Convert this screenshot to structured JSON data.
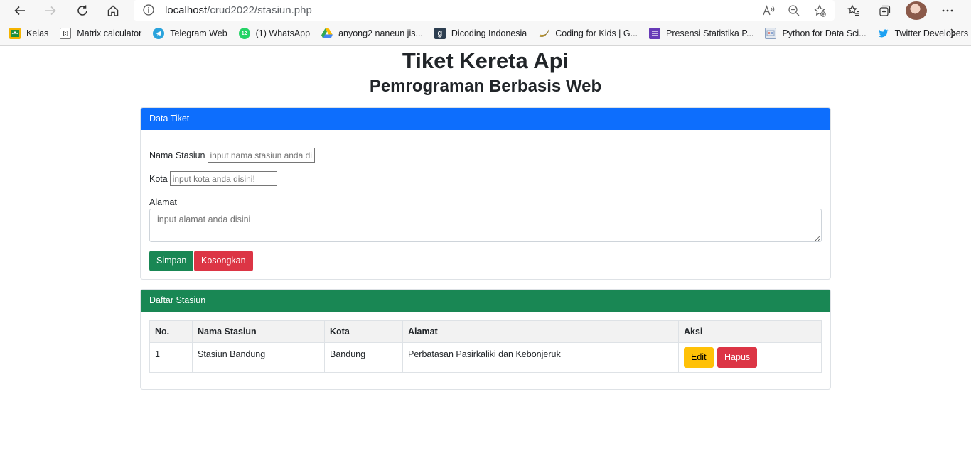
{
  "browser": {
    "url_host": "localhost",
    "url_path": "/crud2022/stasiun.php",
    "bookmarks": [
      {
        "label": "Kelas",
        "icon": "google-classroom-icon",
        "color": "#f5b400"
      },
      {
        "label": "Matrix calculator",
        "icon": "matrix-icon",
        "color": "#ffffff"
      },
      {
        "label": "Telegram Web",
        "icon": "telegram-icon",
        "color": "#2aa3dc"
      },
      {
        "label": "(1) WhatsApp",
        "icon": "whatsapp-icon",
        "color": "#25d366"
      },
      {
        "label": "anyong2 naneun jis...",
        "icon": "google-drive-icon",
        "color": "#34a853"
      },
      {
        "label": "Dicoding Indonesia",
        "icon": "dicoding-icon",
        "color": "#2d3e50"
      },
      {
        "label": "Coding for Kids | G...",
        "icon": "banana-icon",
        "color": "#f2c84b"
      },
      {
        "label": "Presensi Statistika P...",
        "icon": "google-forms-icon",
        "color": "#673ab7"
      },
      {
        "label": "Python for Data Sci...",
        "icon": "python-course-icon",
        "color": "#8aa1c1"
      },
      {
        "label": "Twitter Developers",
        "icon": "twitter-icon",
        "color": "#1da1f2"
      }
    ]
  },
  "page": {
    "title": "Tiket Kereta Api",
    "subtitle": "Pemrograman Berbasis Web"
  },
  "form_card": {
    "header": "Data Tiket",
    "nama_label": "Nama Stasiun",
    "nama_placeholder": "input nama stasiun anda disini!",
    "kota_label": "Kota",
    "kota_placeholder": "input kota anda disini!",
    "alamat_label": "Alamat",
    "alamat_placeholder": "input alamat anda disini",
    "simpan_label": "Simpan",
    "kosongkan_label": "Kosongkan"
  },
  "list_card": {
    "header": "Daftar Stasiun",
    "columns": [
      "No.",
      "Nama Stasiun",
      "Kota",
      "Alamat",
      "Aksi"
    ],
    "rows": [
      {
        "no": "1",
        "nama": "Stasiun Bandung",
        "kota": "Bandung",
        "alamat": "Perbatasan Pasirkaliki dan Kebonjeruk",
        "edit": "Edit",
        "hapus": "Hapus"
      }
    ]
  },
  "colors": {
    "primary": "#0d6efd",
    "success": "#198754",
    "danger": "#dc3545",
    "warning": "#ffc107"
  }
}
